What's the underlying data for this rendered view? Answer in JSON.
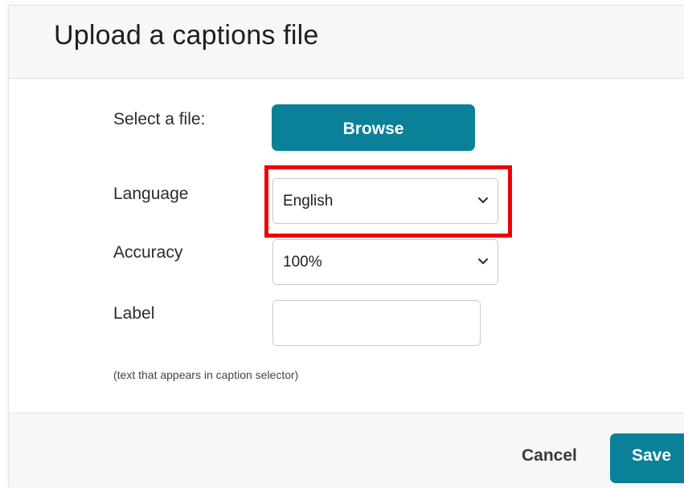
{
  "dialog": {
    "title": "Upload a captions file"
  },
  "form": {
    "file": {
      "label": "Select a file:",
      "button_label": "Browse"
    },
    "language": {
      "label": "Language",
      "selected": "English"
    },
    "accuracy": {
      "label": "Accuracy",
      "selected": "100%"
    },
    "caption_label": {
      "label": "Label",
      "value": "",
      "hint": "(text that appears in caption selector)"
    }
  },
  "footer": {
    "cancel_label": "Cancel",
    "save_label": "Save"
  },
  "colors": {
    "accent": "#0a8199",
    "highlight": "#ee0000",
    "header_bg": "#f7f7f7"
  },
  "icons": {
    "select_arrow": "chevron-down-icon"
  }
}
